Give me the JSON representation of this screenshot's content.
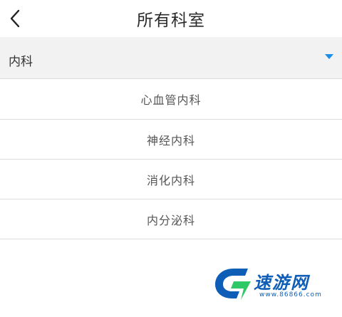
{
  "header": {
    "title": "所有科室"
  },
  "department_select": {
    "selected": "内科"
  },
  "departments": [
    {
      "label": "心血管内科"
    },
    {
      "label": "神经内科"
    },
    {
      "label": "消化内科"
    },
    {
      "label": "内分泌科"
    }
  ],
  "watermark": {
    "name": "速游网",
    "url": "www.86866.com"
  },
  "colors": {
    "accent": "#1a8ee8",
    "select_background": "#f2f2f2",
    "divider": "#dcdcdc",
    "watermark_blue": "#0e5db7",
    "watermark_green": "#2ec866"
  }
}
